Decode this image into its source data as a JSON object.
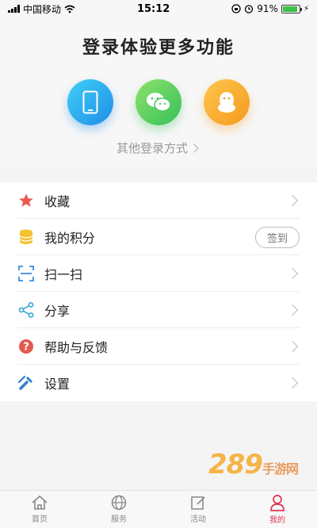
{
  "status_bar": {
    "carrier": "中国移动",
    "time": "15:12",
    "battery": "91%",
    "battery_level": 0.91
  },
  "login": {
    "title": "登录体验更多功能",
    "options": [
      "phone-icon",
      "wechat-icon",
      "qq-icon"
    ],
    "other_login": "其他登录方式",
    "colors": {
      "phone": "#1f8de8",
      "wechat": "#35c05a",
      "qq": "#f59a1e"
    }
  },
  "menu": {
    "items": [
      {
        "label": "收藏",
        "icon": "star-icon"
      },
      {
        "label": "我的积分",
        "icon": "coins-icon",
        "action": "签到"
      },
      {
        "label": "扫一扫",
        "icon": "scan-icon"
      },
      {
        "label": "分享",
        "icon": "share-icon"
      },
      {
        "label": "帮助与反馈",
        "icon": "help-icon"
      },
      {
        "label": "设置",
        "icon": "wrench-icon"
      }
    ]
  },
  "watermark": {
    "text": "289",
    "suffix": "手游网"
  },
  "bottom_nav": {
    "items": [
      {
        "label": "首页",
        "icon": "home-icon"
      },
      {
        "label": "服务",
        "icon": "globe-icon"
      },
      {
        "label": "活动",
        "icon": "edit-icon"
      },
      {
        "label": "我的",
        "icon": "user-icon",
        "active": true
      }
    ],
    "active_color": "#e0334d"
  }
}
